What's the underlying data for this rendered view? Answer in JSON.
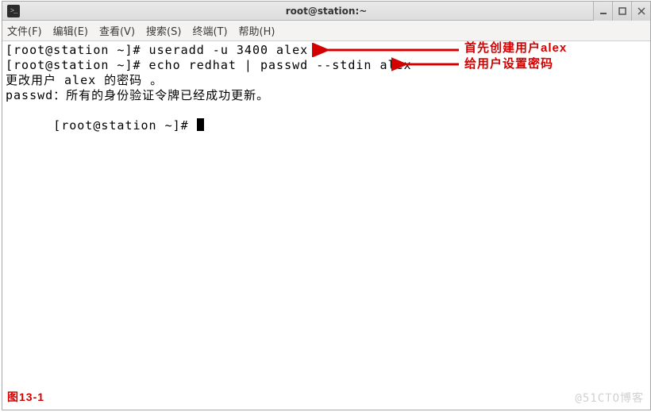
{
  "window": {
    "title": "root@station:~"
  },
  "menu": {
    "file": "文件(F)",
    "edit": "编辑(E)",
    "view": "查看(V)",
    "search": "搜索(S)",
    "terminal": "终端(T)",
    "help": "帮助(H)"
  },
  "terminal": {
    "line1": "[root@station ~]# useradd -u 3400 alex",
    "line2": "[root@station ~]# echo redhat | passwd --stdin alex",
    "line3": "更改用户 alex 的密码 。",
    "line4": "passwd：所有的身份验证令牌已经成功更新。",
    "line5_prompt": "[root@station ~]# "
  },
  "annotations": {
    "create_user": "首先创建用户alex",
    "set_passwd": "给用户设置密码",
    "figure_label": "图13-1"
  },
  "watermark": "@51CTO博客",
  "colors": {
    "annotation_red": "#d40000",
    "titlebar_grad_top": "#eaeaea",
    "titlebar_grad_bottom": "#dcdcdc"
  }
}
